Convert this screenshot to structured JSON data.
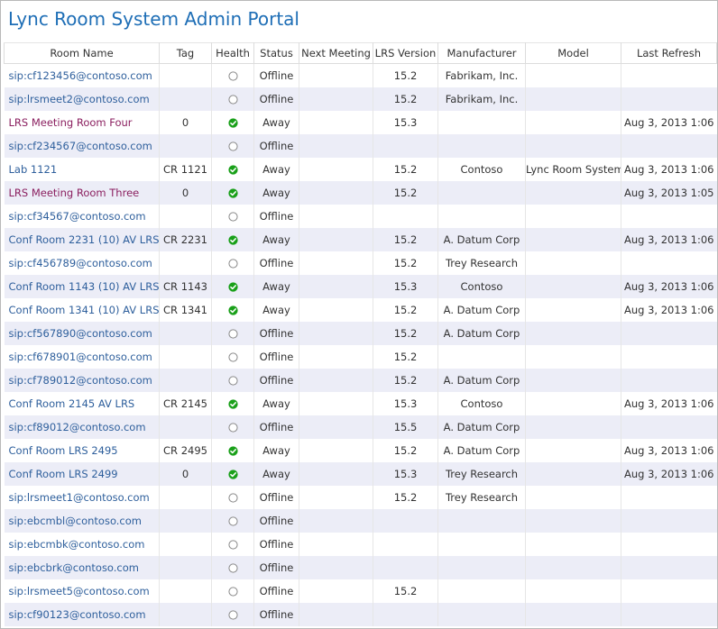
{
  "page": {
    "title": "Lync Room System Admin Portal"
  },
  "columns": [
    "Room Name",
    "Tag",
    "Health",
    "Status",
    "Next Meeting",
    "LRS Version",
    "Manufacturer",
    "Model",
    "Last Refresh"
  ],
  "colors": {
    "title": "#1e6eb6",
    "link_blue": "#2e5f9c",
    "link_purple": "#8b2060",
    "healthy_green": "#1aa01a",
    "alt_row": "#ecedf7"
  },
  "rows": [
    {
      "name": "sip:cf123456@contoso.com",
      "name_style": "blue",
      "tag": "",
      "health": "empty-circle-icon",
      "status": "Offline",
      "next_meeting": "",
      "version": "15.2",
      "manufacturer": "Fabrikam, Inc.",
      "model": "",
      "last_refresh": ""
    },
    {
      "name": "sip:lrsmeet2@contoso.com",
      "name_style": "blue",
      "tag": "",
      "health": "empty-circle-icon",
      "status": "Offline",
      "next_meeting": "",
      "version": "15.2",
      "manufacturer": "Fabrikam, Inc.",
      "model": "",
      "last_refresh": ""
    },
    {
      "name": "LRS Meeting Room Four",
      "name_style": "purple",
      "tag": "0",
      "health": "green-check-icon",
      "status": "Away",
      "next_meeting": "",
      "version": "15.3",
      "manufacturer": "",
      "model": "",
      "last_refresh": "Aug 3, 2013 1:06"
    },
    {
      "name": "sip:cf234567@contoso.com",
      "name_style": "blue",
      "tag": "",
      "health": "empty-circle-icon",
      "status": "Offline",
      "next_meeting": "",
      "version": "",
      "manufacturer": "",
      "model": "",
      "last_refresh": ""
    },
    {
      "name": "Lab 1121",
      "name_style": "blue",
      "tag": "CR 1121",
      "health": "green-check-icon",
      "status": "Away",
      "next_meeting": "",
      "version": "15.2",
      "manufacturer": "Contoso",
      "model": "Lync Room System",
      "last_refresh": "Aug 3, 2013 1:06"
    },
    {
      "name": "LRS Meeting Room Three",
      "name_style": "purple",
      "tag": "0",
      "health": "green-check-icon",
      "status": "Away",
      "next_meeting": "",
      "version": "15.2",
      "manufacturer": "",
      "model": "",
      "last_refresh": "Aug 3, 2013 1:05"
    },
    {
      "name": "sip:cf34567@contoso.com",
      "name_style": "blue",
      "tag": "",
      "health": "empty-circle-icon",
      "status": "Offline",
      "next_meeting": "",
      "version": "",
      "manufacturer": "",
      "model": "",
      "last_refresh": ""
    },
    {
      "name": "Conf Room 2231 (10) AV LRS",
      "name_style": "blue",
      "tag": "CR 2231",
      "health": "green-check-icon",
      "status": "Away",
      "next_meeting": "",
      "version": "15.2",
      "manufacturer": "A. Datum Corp",
      "model": "",
      "last_refresh": "Aug 3, 2013 1:06"
    },
    {
      "name": "sip:cf456789@contoso.com",
      "name_style": "blue",
      "tag": "",
      "health": "empty-circle-icon",
      "status": "Offline",
      "next_meeting": "",
      "version": "15.2",
      "manufacturer": "Trey Research",
      "model": "",
      "last_refresh": ""
    },
    {
      "name": "Conf Room 1143 (10) AV LRS",
      "name_style": "blue",
      "tag": "CR 1143",
      "health": "green-check-icon",
      "status": "Away",
      "next_meeting": "",
      "version": "15.3",
      "manufacturer": "Contoso",
      "model": "",
      "last_refresh": "Aug 3, 2013 1:06"
    },
    {
      "name": "Conf Room 1341 (10) AV LRS",
      "name_style": "blue",
      "tag": "CR 1341",
      "health": "green-check-icon",
      "status": "Away",
      "next_meeting": "",
      "version": "15.2",
      "manufacturer": "A. Datum Corp",
      "model": "",
      "last_refresh": "Aug 3, 2013 1:06"
    },
    {
      "name": "sip:cf567890@contoso.com",
      "name_style": "blue",
      "tag": "",
      "health": "empty-circle-icon",
      "status": "Offline",
      "next_meeting": "",
      "version": "15.2",
      "manufacturer": "A. Datum Corp",
      "model": "",
      "last_refresh": ""
    },
    {
      "name": "sip:cf678901@contoso.com",
      "name_style": "blue",
      "tag": "",
      "health": "empty-circle-icon",
      "status": "Offline",
      "next_meeting": "",
      "version": "15.2",
      "manufacturer": "",
      "model": "",
      "last_refresh": ""
    },
    {
      "name": "sip:cf789012@contoso.com",
      "name_style": "blue",
      "tag": "",
      "health": "empty-circle-icon",
      "status": "Offline",
      "next_meeting": "",
      "version": "15.2",
      "manufacturer": "A. Datum Corp",
      "model": "",
      "last_refresh": ""
    },
    {
      "name": "Conf Room 2145 AV LRS",
      "name_style": "blue",
      "tag": "CR 2145",
      "health": "green-check-icon",
      "status": "Away",
      "next_meeting": "",
      "version": "15.3",
      "manufacturer": "Contoso",
      "model": "",
      "last_refresh": "Aug 3, 2013 1:06"
    },
    {
      "name": "sip:cf89012@contoso.com",
      "name_style": "blue",
      "tag": "",
      "health": "empty-circle-icon",
      "status": "Offline",
      "next_meeting": "",
      "version": "15.5",
      "manufacturer": "A. Datum Corp",
      "model": "",
      "last_refresh": ""
    },
    {
      "name": "Conf Room LRS 2495",
      "name_style": "blue",
      "tag": "CR 2495",
      "health": "green-check-icon",
      "status": "Away",
      "next_meeting": "",
      "version": "15.2",
      "manufacturer": "A. Datum Corp",
      "model": "",
      "last_refresh": "Aug 3, 2013 1:06"
    },
    {
      "name": "Conf Room LRS 2499",
      "name_style": "blue",
      "tag": "0",
      "health": "green-check-icon",
      "status": "Away",
      "next_meeting": "",
      "version": "15.3",
      "manufacturer": "Trey Research",
      "model": "",
      "last_refresh": "Aug 3, 2013 1:06"
    },
    {
      "name": "sip:lrsmeet1@contoso.com",
      "name_style": "blue",
      "tag": "",
      "health": "empty-circle-icon",
      "status": "Offline",
      "next_meeting": "",
      "version": "15.2",
      "manufacturer": "Trey Research",
      "model": "",
      "last_refresh": ""
    },
    {
      "name": "sip:ebcmbl@contoso.com",
      "name_style": "blue",
      "tag": "",
      "health": "empty-circle-icon",
      "status": "Offline",
      "next_meeting": "",
      "version": "",
      "manufacturer": "",
      "model": "",
      "last_refresh": ""
    },
    {
      "name": "sip:ebcmbk@contoso.com",
      "name_style": "blue",
      "tag": "",
      "health": "empty-circle-icon",
      "status": "Offline",
      "next_meeting": "",
      "version": "",
      "manufacturer": "",
      "model": "",
      "last_refresh": ""
    },
    {
      "name": "sip:ebcbrk@contoso.com",
      "name_style": "blue",
      "tag": "",
      "health": "empty-circle-icon",
      "status": "Offline",
      "next_meeting": "",
      "version": "",
      "manufacturer": "",
      "model": "",
      "last_refresh": ""
    },
    {
      "name": "sip:lrsmeet5@contoso.com",
      "name_style": "blue",
      "tag": "",
      "health": "empty-circle-icon",
      "status": "Offline",
      "next_meeting": "",
      "version": "15.2",
      "manufacturer": "",
      "model": "",
      "last_refresh": ""
    },
    {
      "name": "sip:cf90123@contoso.com",
      "name_style": "blue",
      "tag": "",
      "health": "empty-circle-icon",
      "status": "Offline",
      "next_meeting": "",
      "version": "",
      "manufacturer": "",
      "model": "",
      "last_refresh": ""
    }
  ]
}
